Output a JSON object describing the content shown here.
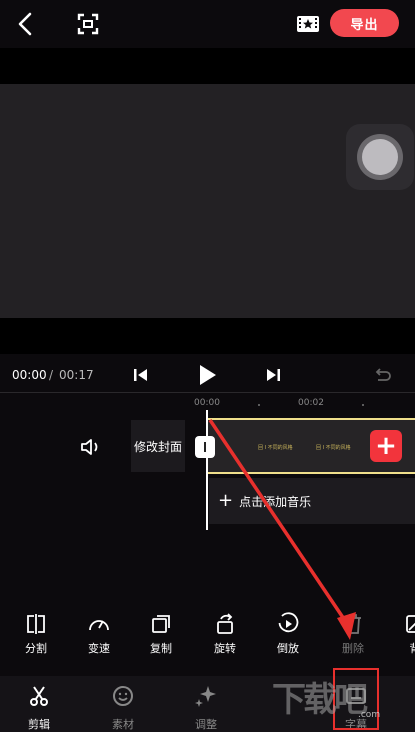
{
  "header": {
    "export_label": "导出"
  },
  "player": {
    "current_time": "00:00",
    "separator": "/",
    "total_time": "00:17"
  },
  "ruler": {
    "ticks": [
      "00:00",
      "00:02"
    ]
  },
  "timeline": {
    "cover_label": "修改封面",
    "add_music_label": "点击添加音乐",
    "frame_texts": [
      "回 I 不同的风格",
      "回 I 不同的风格"
    ]
  },
  "toolbar": {
    "items": [
      {
        "label": "分割",
        "icon": "split-icon"
      },
      {
        "label": "变速",
        "icon": "speed-icon"
      },
      {
        "label": "复制",
        "icon": "copy-icon"
      },
      {
        "label": "旋转",
        "icon": "rotate-icon"
      },
      {
        "label": "倒放",
        "icon": "reverse-icon"
      },
      {
        "label": "删除",
        "icon": "delete-icon"
      },
      {
        "label": "背",
        "icon": "background-icon"
      }
    ]
  },
  "tabs": [
    {
      "label": "剪辑",
      "icon": "scissors-icon",
      "active": true
    },
    {
      "label": "素材",
      "icon": "sticker-icon",
      "active": false
    },
    {
      "label": "调整",
      "icon": "sparkle-icon",
      "active": false
    },
    {
      "label": "字幕",
      "icon": "subtitle-icon",
      "active": false
    }
  ],
  "watermark": {
    "main": "下载吧",
    "sub": ".com"
  },
  "colors": {
    "accent": "#f2484f",
    "clip_border": "#f0e08c",
    "highlight": "#e8302d"
  }
}
